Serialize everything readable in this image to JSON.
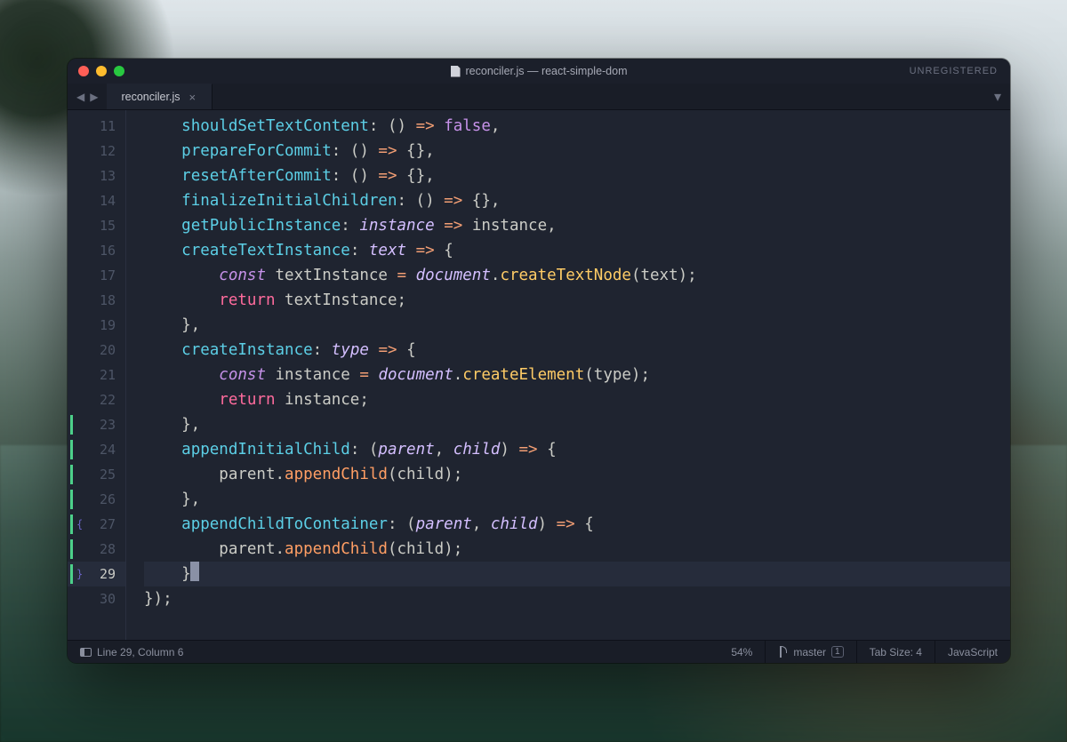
{
  "window": {
    "title": "reconciler.js — react-simple-dom",
    "registration": "UNREGISTERED"
  },
  "tabs": {
    "active": "reconciler.js"
  },
  "gutter": {
    "lines": [
      {
        "n": 11,
        "mod": false,
        "fold": ""
      },
      {
        "n": 12,
        "mod": false,
        "fold": ""
      },
      {
        "n": 13,
        "mod": false,
        "fold": ""
      },
      {
        "n": 14,
        "mod": false,
        "fold": ""
      },
      {
        "n": 15,
        "mod": false,
        "fold": ""
      },
      {
        "n": 16,
        "mod": false,
        "fold": ""
      },
      {
        "n": 17,
        "mod": false,
        "fold": ""
      },
      {
        "n": 18,
        "mod": false,
        "fold": ""
      },
      {
        "n": 19,
        "mod": false,
        "fold": ""
      },
      {
        "n": 20,
        "mod": false,
        "fold": ""
      },
      {
        "n": 21,
        "mod": false,
        "fold": ""
      },
      {
        "n": 22,
        "mod": false,
        "fold": ""
      },
      {
        "n": 23,
        "mod": true,
        "fold": ""
      },
      {
        "n": 24,
        "mod": true,
        "fold": ""
      },
      {
        "n": 25,
        "mod": true,
        "fold": ""
      },
      {
        "n": 26,
        "mod": true,
        "fold": ""
      },
      {
        "n": 27,
        "mod": true,
        "fold": "{"
      },
      {
        "n": 28,
        "mod": true,
        "fold": ""
      },
      {
        "n": 29,
        "mod": true,
        "fold": "}",
        "current": true
      },
      {
        "n": 30,
        "mod": false,
        "fold": ""
      }
    ]
  },
  "code": [
    [
      {
        "c": "k-ident",
        "t": "    "
      },
      {
        "c": "k-prop",
        "t": "shouldSetTextContent"
      },
      {
        "c": "k-punc",
        "t": ": () "
      },
      {
        "c": "k-op",
        "t": "=>"
      },
      {
        "c": "k-punc",
        "t": " "
      },
      {
        "c": "k-bool",
        "t": "false"
      },
      {
        "c": "k-punc",
        "t": ","
      }
    ],
    [
      {
        "c": "k-ident",
        "t": "    "
      },
      {
        "c": "k-prop",
        "t": "prepareForCommit"
      },
      {
        "c": "k-punc",
        "t": ": () "
      },
      {
        "c": "k-op",
        "t": "=>"
      },
      {
        "c": "k-punc",
        "t": " {},"
      }
    ],
    [
      {
        "c": "k-ident",
        "t": "    "
      },
      {
        "c": "k-prop",
        "t": "resetAfterCommit"
      },
      {
        "c": "k-punc",
        "t": ": () "
      },
      {
        "c": "k-op",
        "t": "=>"
      },
      {
        "c": "k-punc",
        "t": " {},"
      }
    ],
    [
      {
        "c": "k-ident",
        "t": "    "
      },
      {
        "c": "k-prop",
        "t": "finalizeInitialChildren"
      },
      {
        "c": "k-punc",
        "t": ": () "
      },
      {
        "c": "k-op",
        "t": "=>"
      },
      {
        "c": "k-punc",
        "t": " {},"
      }
    ],
    [
      {
        "c": "k-ident",
        "t": "    "
      },
      {
        "c": "k-prop",
        "t": "getPublicInstance"
      },
      {
        "c": "k-punc",
        "t": ": "
      },
      {
        "c": "k-param",
        "t": "instance"
      },
      {
        "c": "k-punc",
        "t": " "
      },
      {
        "c": "k-op",
        "t": "=>"
      },
      {
        "c": "k-punc",
        "t": " instance,"
      }
    ],
    [
      {
        "c": "k-ident",
        "t": "    "
      },
      {
        "c": "k-prop",
        "t": "createTextInstance"
      },
      {
        "c": "k-punc",
        "t": ": "
      },
      {
        "c": "k-param",
        "t": "text"
      },
      {
        "c": "k-punc",
        "t": " "
      },
      {
        "c": "k-op",
        "t": "=>"
      },
      {
        "c": "k-punc",
        "t": " {"
      }
    ],
    [
      {
        "c": "k-ident",
        "t": "        "
      },
      {
        "c": "k-kwd",
        "t": "const"
      },
      {
        "c": "k-ident",
        "t": " textInstance "
      },
      {
        "c": "k-op",
        "t": "="
      },
      {
        "c": "k-ident",
        "t": " "
      },
      {
        "c": "k-obj",
        "t": "document"
      },
      {
        "c": "k-punc",
        "t": "."
      },
      {
        "c": "k-call",
        "t": "createTextNode"
      },
      {
        "c": "k-punc",
        "t": "(text);"
      }
    ],
    [
      {
        "c": "k-ident",
        "t": "        "
      },
      {
        "c": "k-kwd2",
        "t": "return"
      },
      {
        "c": "k-ident",
        "t": " textInstance;"
      }
    ],
    [
      {
        "c": "k-ident",
        "t": "    },"
      }
    ],
    [
      {
        "c": "k-ident",
        "t": "    "
      },
      {
        "c": "k-prop",
        "t": "createInstance"
      },
      {
        "c": "k-punc",
        "t": ": "
      },
      {
        "c": "k-param",
        "t": "type"
      },
      {
        "c": "k-punc",
        "t": " "
      },
      {
        "c": "k-op",
        "t": "=>"
      },
      {
        "c": "k-punc",
        "t": " {"
      }
    ],
    [
      {
        "c": "k-ident",
        "t": "        "
      },
      {
        "c": "k-kwd",
        "t": "const"
      },
      {
        "c": "k-ident",
        "t": " instance "
      },
      {
        "c": "k-op",
        "t": "="
      },
      {
        "c": "k-ident",
        "t": " "
      },
      {
        "c": "k-obj",
        "t": "document"
      },
      {
        "c": "k-punc",
        "t": "."
      },
      {
        "c": "k-call",
        "t": "createElement"
      },
      {
        "c": "k-punc",
        "t": "(type);"
      }
    ],
    [
      {
        "c": "k-ident",
        "t": "        "
      },
      {
        "c": "k-kwd2",
        "t": "return"
      },
      {
        "c": "k-ident",
        "t": " instance;"
      }
    ],
    [
      {
        "c": "k-ident",
        "t": "    },"
      }
    ],
    [
      {
        "c": "k-ident",
        "t": "    "
      },
      {
        "c": "k-prop",
        "t": "appendInitialChild"
      },
      {
        "c": "k-punc",
        "t": ": ("
      },
      {
        "c": "k-param",
        "t": "parent"
      },
      {
        "c": "k-punc",
        "t": ", "
      },
      {
        "c": "k-param",
        "t": "child"
      },
      {
        "c": "k-punc",
        "t": ") "
      },
      {
        "c": "k-op",
        "t": "=>"
      },
      {
        "c": "k-punc",
        "t": " {"
      }
    ],
    [
      {
        "c": "k-ident",
        "t": "        parent."
      },
      {
        "c": "k-call2",
        "t": "appendChild"
      },
      {
        "c": "k-punc",
        "t": "(child);"
      }
    ],
    [
      {
        "c": "k-ident",
        "t": "    },"
      }
    ],
    [
      {
        "c": "k-ident",
        "t": "    "
      },
      {
        "c": "k-prop",
        "t": "appendChildToContainer"
      },
      {
        "c": "k-punc",
        "t": ": ("
      },
      {
        "c": "k-param",
        "t": "parent"
      },
      {
        "c": "k-punc",
        "t": ", "
      },
      {
        "c": "k-param",
        "t": "child"
      },
      {
        "c": "k-punc",
        "t": ") "
      },
      {
        "c": "k-op",
        "t": "=>"
      },
      {
        "c": "k-punc",
        "t": " {"
      }
    ],
    [
      {
        "c": "k-ident",
        "t": "        parent."
      },
      {
        "c": "k-call2",
        "t": "appendChild"
      },
      {
        "c": "k-punc",
        "t": "(child);"
      }
    ],
    [
      {
        "c": "k-ident",
        "t": "    }"
      },
      {
        "c": "cursor",
        "t": ""
      }
    ],
    [
      {
        "c": "k-ident",
        "t": "});"
      }
    ]
  ],
  "status": {
    "position": "Line 29, Column 6",
    "percent": "54%",
    "branch": "master",
    "branch_badge": "1",
    "tabsize": "Tab Size: 4",
    "language": "JavaScript"
  }
}
